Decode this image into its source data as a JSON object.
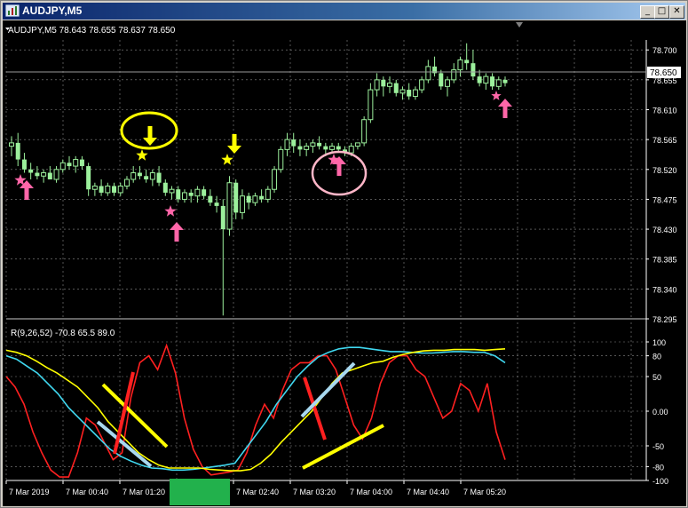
{
  "window": {
    "title": "AUDJPY,M5",
    "minimize_glyph": "_",
    "maximize_glyph": "□",
    "close_glyph": "✕"
  },
  "chart_header": "AUDJPY,M5  78.643 78.655 78.637 78.650",
  "indicator_label": "R(9,26,52) -70.8 65.5 89.0",
  "price_label_current": "78.650",
  "colors": {
    "bg": "#000000",
    "grid": "#8a8a8a",
    "candle": "#9cf09c",
    "red": "#ff2020",
    "cyan": "#40d8f0",
    "yellow": "#ffff00",
    "pink": "#ff66a8",
    "green": "#22b14c"
  },
  "chart_data": [
    {
      "type": "candlestick",
      "price_axis": {
        "ticks": [
          "78.700",
          "78.655",
          "78.610",
          "78.565",
          "78.520",
          "78.475",
          "78.430",
          "78.385",
          "78.340",
          "78.295"
        ],
        "ylim": [
          78.295,
          78.715
        ]
      },
      "time_axis": {
        "ticks": [
          "7 Mar 2019",
          "7 Mar 00:40",
          "7 Mar 01:20",
          "7 Mar 02:40",
          "7 Mar 03:20",
          "7 Mar 04:00",
          "7 Mar 04:40",
          "7 Mar 05:20"
        ]
      },
      "candles": [
        [
          78.555,
          78.57,
          78.54,
          78.56
        ],
        [
          78.56,
          78.575,
          78.525,
          78.535
        ],
        [
          78.535,
          78.545,
          78.515,
          78.52
        ],
        [
          78.52,
          78.53,
          78.505,
          78.515
        ],
        [
          78.515,
          78.525,
          78.505,
          78.51
        ],
        [
          78.51,
          78.52,
          78.5,
          78.515
        ],
        [
          78.515,
          78.525,
          78.505,
          78.505
        ],
        [
          78.505,
          78.525,
          78.5,
          78.52
        ],
        [
          78.52,
          78.535,
          78.515,
          78.53
        ],
        [
          78.53,
          78.54,
          78.52,
          78.525
        ],
        [
          78.525,
          78.54,
          78.515,
          78.535
        ],
        [
          78.535,
          78.54,
          78.52,
          78.525
        ],
        [
          78.525,
          78.53,
          78.48,
          78.49
        ],
        [
          78.49,
          78.5,
          78.48,
          78.495
        ],
        [
          78.495,
          78.505,
          78.48,
          78.485
        ],
        [
          78.485,
          78.5,
          78.48,
          78.495
        ],
        [
          78.495,
          78.5,
          78.48,
          78.485
        ],
        [
          78.485,
          78.5,
          78.48,
          78.495
        ],
        [
          78.495,
          78.51,
          78.49,
          78.505
        ],
        [
          78.505,
          78.525,
          78.5,
          78.515
        ],
        [
          78.515,
          78.525,
          78.505,
          78.51
        ],
        [
          78.51,
          78.52,
          78.5,
          78.505
        ],
        [
          78.505,
          78.52,
          78.495,
          78.515
        ],
        [
          78.515,
          78.525,
          78.495,
          78.5
        ],
        [
          78.5,
          78.505,
          78.48,
          78.485
        ],
        [
          78.485,
          78.495,
          78.475,
          78.49
        ],
        [
          78.49,
          78.495,
          78.47,
          78.475
        ],
        [
          78.475,
          78.49,
          78.47,
          78.485
        ],
        [
          78.485,
          78.49,
          78.47,
          78.48
        ],
        [
          78.48,
          78.495,
          78.47,
          78.49
        ],
        [
          78.49,
          78.495,
          78.475,
          78.48
        ],
        [
          78.48,
          78.49,
          78.465,
          78.47
        ],
        [
          78.47,
          78.48,
          78.455,
          78.465
        ],
        [
          78.465,
          78.475,
          78.3,
          78.43
        ],
        [
          78.43,
          78.51,
          78.42,
          78.5
        ],
        [
          78.5,
          78.505,
          78.445,
          78.455
        ],
        [
          78.455,
          78.49,
          78.445,
          78.48
        ],
        [
          78.48,
          78.485,
          78.46,
          78.47
        ],
        [
          78.47,
          78.485,
          78.465,
          78.48
        ],
        [
          78.48,
          78.49,
          78.47,
          78.475
        ],
        [
          78.475,
          78.495,
          78.47,
          78.49
        ],
        [
          78.49,
          78.525,
          78.485,
          78.52
        ],
        [
          78.52,
          78.555,
          78.515,
          78.55
        ],
        [
          78.55,
          78.575,
          78.54,
          78.565
        ],
        [
          78.565,
          78.575,
          78.545,
          78.555
        ],
        [
          78.555,
          78.565,
          78.54,
          78.55
        ],
        [
          78.55,
          78.56,
          78.54,
          78.555
        ],
        [
          78.555,
          78.565,
          78.545,
          78.56
        ],
        [
          78.56,
          78.57,
          78.55,
          78.555
        ],
        [
          78.555,
          78.56,
          78.54,
          78.55
        ],
        [
          78.55,
          78.56,
          78.545,
          78.555
        ],
        [
          78.555,
          78.56,
          78.545,
          78.55
        ],
        [
          78.55,
          78.555,
          78.54,
          78.545
        ],
        [
          78.545,
          78.56,
          78.54,
          78.555
        ],
        [
          78.555,
          78.56,
          78.55,
          78.56
        ],
        [
          78.56,
          78.6,
          78.555,
          78.595
        ],
        [
          78.595,
          78.65,
          78.59,
          78.64
        ],
        [
          78.64,
          78.665,
          78.63,
          78.655
        ],
        [
          78.655,
          78.66,
          78.63,
          78.645
        ],
        [
          78.645,
          78.66,
          78.635,
          78.65
        ],
        [
          78.65,
          78.655,
          78.63,
          78.635
        ],
        [
          78.635,
          78.645,
          78.625,
          78.64
        ],
        [
          78.64,
          78.65,
          78.625,
          78.63
        ],
        [
          78.63,
          78.645,
          78.625,
          78.64
        ],
        [
          78.64,
          78.66,
          78.635,
          78.655
        ],
        [
          78.655,
          78.685,
          78.65,
          78.675
        ],
        [
          78.675,
          78.69,
          78.66,
          78.665
        ],
        [
          78.665,
          78.67,
          78.64,
          78.645
        ],
        [
          78.645,
          78.66,
          78.63,
          78.655
        ],
        [
          78.655,
          78.68,
          78.65,
          78.67
        ],
        [
          78.67,
          78.69,
          78.66,
          78.685
        ],
        [
          78.685,
          78.71,
          78.67,
          78.68
        ],
        [
          78.68,
          78.7,
          78.655,
          78.66
        ],
        [
          78.66,
          78.67,
          78.645,
          78.65
        ],
        [
          78.65,
          78.665,
          78.64,
          78.66
        ],
        [
          78.66,
          78.665,
          78.64,
          78.645
        ],
        [
          78.645,
          78.66,
          78.64,
          78.655
        ],
        [
          78.655,
          78.66,
          78.645,
          78.65
        ]
      ]
    },
    {
      "type": "line",
      "axis": {
        "ticks": [
          "100",
          "80",
          "50",
          "0.00",
          "-50",
          "-80",
          "-100"
        ],
        "ylim": [
          -100,
          100
        ]
      },
      "series": [
        {
          "color": "red",
          "values": [
            50,
            35,
            10,
            -30,
            -60,
            -85,
            -95,
            -95,
            -60,
            -10,
            -20,
            -45,
            -70,
            -60,
            20,
            70,
            80,
            60,
            95,
            55,
            -10,
            -55,
            -80,
            -92,
            -90,
            -88,
            -85,
            -60,
            -20,
            10,
            -10,
            30,
            60,
            70,
            70,
            80,
            80,
            60,
            20,
            -20,
            -40,
            -10,
            40,
            70,
            80,
            80,
            60,
            50,
            20,
            -10,
            0,
            40,
            30,
            0,
            40,
            -30,
            -70
          ]
        },
        {
          "color": "cyan",
          "values": [
            80,
            75,
            65,
            55,
            40,
            25,
            5,
            -10,
            -25,
            -40,
            -55,
            -65,
            -72,
            -78,
            -82,
            -83,
            -85,
            -85,
            -84,
            -82,
            -80,
            -78,
            -75,
            -55,
            -35,
            -15,
            10,
            30,
            50,
            65,
            78,
            85,
            90,
            92,
            92,
            90,
            88,
            86,
            86,
            85,
            84,
            84,
            85,
            86,
            86,
            85,
            85,
            80,
            70
          ]
        },
        {
          "color": "yellow",
          "values": [
            88,
            85,
            80,
            72,
            63,
            55,
            45,
            35,
            20,
            5,
            -15,
            -30,
            -45,
            -60,
            -70,
            -78,
            -82,
            -82,
            -82,
            -82,
            -84,
            -85,
            -86,
            -86,
            -84,
            -75,
            -62,
            -45,
            -30,
            -15,
            0,
            20,
            40,
            55,
            60,
            65,
            70,
            72,
            78,
            82,
            85,
            87,
            88,
            88,
            89,
            89,
            89,
            88,
            89,
            90
          ]
        }
      ]
    }
  ]
}
